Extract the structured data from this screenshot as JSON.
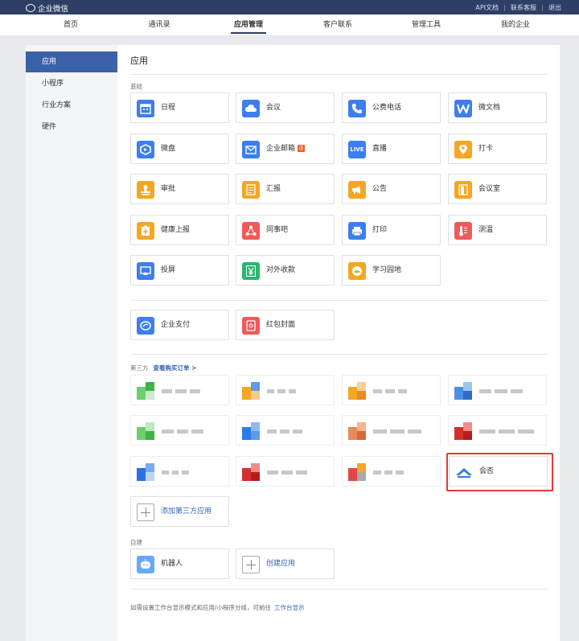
{
  "app": {
    "logo_text": "企业微信"
  },
  "toplinks": [
    "API文档",
    "联系客服",
    "退出"
  ],
  "nav": {
    "tabs": [
      "首页",
      "通讯录",
      "应用管理",
      "客户联系",
      "管理工具",
      "我的企业"
    ],
    "active_index": 2
  },
  "sidebar": {
    "items": [
      "应用",
      "小程序",
      "行业方案",
      "硬件"
    ],
    "active_index": 0
  },
  "main": {
    "title": "应用",
    "basic_label": "基础",
    "basic_apps": [
      {
        "label": "日程",
        "icon": "calendar-icon",
        "color": "#3d7ef0"
      },
      {
        "label": "会议",
        "icon": "cloud-meeting-icon",
        "color": "#3d7ef0"
      },
      {
        "label": "公费电话",
        "icon": "phone-icon",
        "color": "#3d7ef0"
      },
      {
        "label": "微文档",
        "icon": "document-w-icon",
        "color": "#3d7ef0"
      },
      {
        "label": "微盘",
        "icon": "drive-icon",
        "color": "#3d7ef0"
      },
      {
        "label": "企业邮箱",
        "icon": "mail-icon",
        "color": "#3d7ef0",
        "badge": "送"
      },
      {
        "label": "直播",
        "icon": "live-icon",
        "color": "#3d7ef0",
        "icon_text": "LIVE"
      },
      {
        "label": "打卡",
        "icon": "location-icon",
        "color": "#f5a623"
      },
      {
        "label": "审批",
        "icon": "stamp-icon",
        "color": "#f5a623"
      },
      {
        "label": "汇报",
        "icon": "report-icon",
        "color": "#f5a623"
      },
      {
        "label": "公告",
        "icon": "megaphone-icon",
        "color": "#f5a623"
      },
      {
        "label": "会议室",
        "icon": "door-icon",
        "color": "#f5a623"
      },
      {
        "label": "健康上报",
        "icon": "health-icon",
        "color": "#f5a623"
      },
      {
        "label": "同事吧",
        "icon": "share-icon",
        "color": "#f05a5a"
      },
      {
        "label": "打印",
        "icon": "printer-icon",
        "color": "#3d7ef0"
      },
      {
        "label": "测温",
        "icon": "thermometer-icon",
        "color": "#f05a5a"
      },
      {
        "label": "投屏",
        "icon": "screencast-icon",
        "color": "#3d7ef0"
      },
      {
        "label": "对外收款",
        "icon": "yuan-icon",
        "color": "#2bb673"
      },
      {
        "label": "学习园地",
        "icon": "study-icon",
        "color": "#f5a623"
      }
    ],
    "payment_apps": [
      {
        "label": "企业支付",
        "icon": "wallet-icon",
        "color": "#3d7ef0"
      },
      {
        "label": "红包封面",
        "icon": "red-envelope-icon",
        "color": "#f05a5a"
      }
    ],
    "third_party_label": "第三方",
    "third_party_link": "查看购买订单 >",
    "third_party_highlight_app": {
      "label": "会否",
      "icon": "mountain-logo-icon",
      "color": "#2d7be6"
    },
    "add_third_party_label": "添加第三方应用",
    "custom_label": "自建",
    "custom_apps": [
      {
        "label": "机器人",
        "icon": "robot-icon",
        "color": "#6aa8f7"
      }
    ],
    "create_app_label": "创建应用",
    "footer_text": "如需设置工作台显示模式和应用/小程序分组，可前往",
    "footer_link": "工作台显示"
  }
}
